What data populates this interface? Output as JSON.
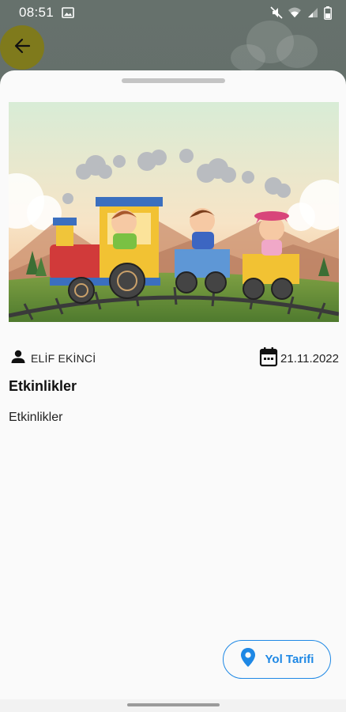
{
  "status_bar": {
    "time": "08:51",
    "icons": [
      "image-icon",
      "mute-icon",
      "wifi-icon",
      "signal-icon",
      "battery-icon"
    ]
  },
  "back_button": {
    "icon": "arrow-left-icon"
  },
  "post": {
    "image": "train-with-children-illustration",
    "author": "ELİF EKİNCİ",
    "date": "21.11.2022",
    "title": "Etkinlikler",
    "body": "Etkinlikler"
  },
  "directions_button": {
    "label": "Yol Tarifi",
    "icon": "map-pin-icon"
  },
  "colors": {
    "accent": "#1e88e5",
    "back_button_bg": "#7f7a1c",
    "sheet_bg": "#fafafa"
  }
}
